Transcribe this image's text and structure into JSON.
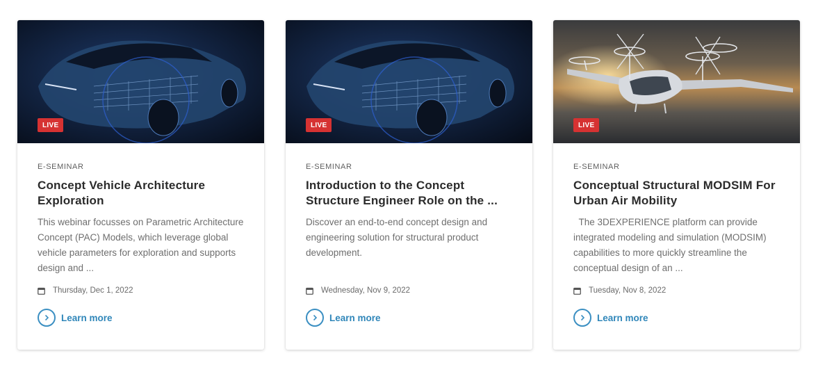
{
  "cards": [
    {
      "badge": "LIVE",
      "category": "E-SEMINAR",
      "title": "Concept Vehicle Architecture Exploration",
      "description": "This webinar focusses on Parametric Architecture Concept (PAC) Models, which leverage global vehicle parameters for exploration and supports design and ...",
      "date": "Thursday, Dec 1, 2022",
      "cta": "Learn more",
      "image": "car-structure-render"
    },
    {
      "badge": "LIVE",
      "category": "E-SEMINAR",
      "title": "Introduction to the Concept Structure Engineer Role on the ...",
      "description": "Discover an end-to-end concept design and engineering solution for structural product development.",
      "date": "Wednesday, Nov 9, 2022",
      "cta": "Learn more",
      "image": "car-structure-render"
    },
    {
      "badge": "LIVE",
      "category": "E-SEMINAR",
      "title": "Conceptual Structural MODSIM For Urban Air Mobility",
      "description": "  The 3DEXPERIENCE platform can provide integrated modeling and simulation (MODSIM) capabilities to more quickly streamline the conceptual design of an ...",
      "date": "Tuesday, Nov 8, 2022",
      "cta": "Learn more",
      "image": "air-taxi-sunset"
    }
  ],
  "colors": {
    "live_badge": "#d63232",
    "link": "#2f86b9",
    "title": "#2b2b2b",
    "text": "#6e6e6e"
  }
}
